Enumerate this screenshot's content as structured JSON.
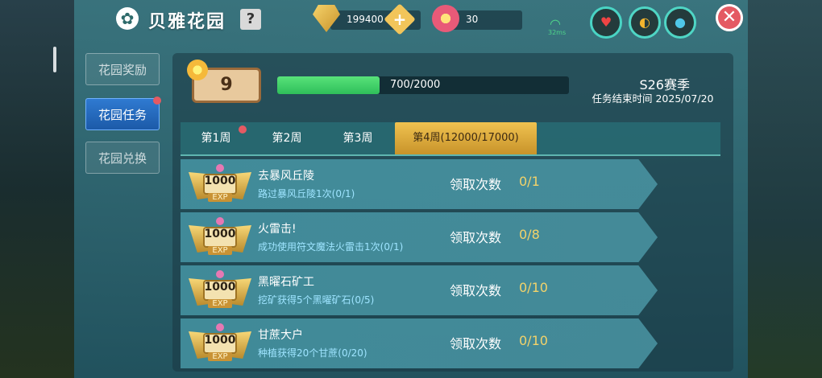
{
  "header": {
    "title": "贝雅花园",
    "help_label": "?",
    "diamonds": "199400",
    "flowers": "30",
    "ping": "32ms",
    "close_label": "✕"
  },
  "sidebar": {
    "items": [
      {
        "label": "花园奖励",
        "active": false
      },
      {
        "label": "花园任务",
        "active": true
      },
      {
        "label": "花园兑换",
        "active": false
      }
    ]
  },
  "level": {
    "value": "9",
    "progress_text": "700/2000",
    "progress_fraction": 0.35
  },
  "season": {
    "title": "S26赛季",
    "end_text": "任务结束时间 2025/07/20"
  },
  "weeks": [
    {
      "label": "第1周",
      "active": false
    },
    {
      "label": "第2周",
      "active": false
    },
    {
      "label": "第3周",
      "active": false
    },
    {
      "label": "第4周(12000/17000)",
      "active": true
    }
  ],
  "tasks": [
    {
      "reward": "1000",
      "reward_type": "EXP",
      "name": "去暴风丘陵",
      "desc": "路过暴风丘陵1次(0/1)",
      "claim_label": "领取次数",
      "claim_count": "0/1"
    },
    {
      "reward": "1000",
      "reward_type": "EXP",
      "name": "火雷击!",
      "desc": "成功使用符文魔法火雷击1次(0/1)",
      "claim_label": "领取次数",
      "claim_count": "0/8"
    },
    {
      "reward": "1000",
      "reward_type": "EXP",
      "name": "黑曜石矿工",
      "desc": "挖矿获得5个黑曜矿石(0/5)",
      "claim_label": "领取次数",
      "claim_count": "0/10"
    },
    {
      "reward": "1000",
      "reward_type": "EXP",
      "name": "甘蔗大户",
      "desc": "种植获得20个甘蔗(0/20)",
      "claim_label": "领取次数",
      "claim_count": "0/10"
    }
  ],
  "colors": {
    "accent_gold": "#f0c250",
    "progress_green": "#2fbf5a",
    "alert_red": "#e45a63"
  }
}
